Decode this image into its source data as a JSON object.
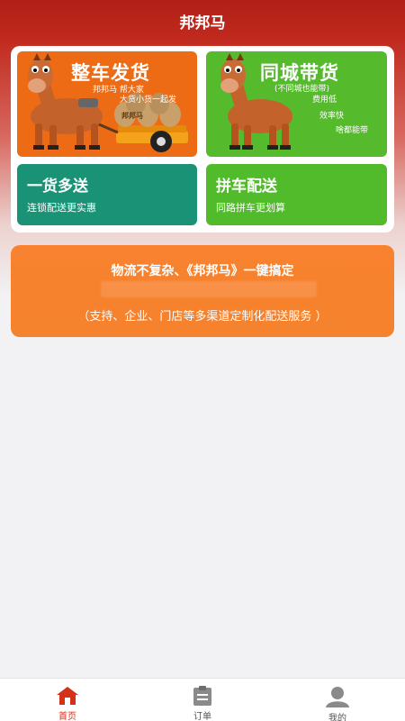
{
  "app": {
    "title": "邦邦马"
  },
  "tiles": {
    "whole_truck": {
      "title": "整车发货",
      "lines": [
        "邦邦马 帮大家",
        "大货小货一起发"
      ],
      "cart_label": "邦邦马"
    },
    "same_city": {
      "title": "同城带货",
      "subtitle": "(不同城也能带)",
      "features": [
        "费用低",
        "效率快",
        "啥都能带"
      ]
    },
    "multi_delivery": {
      "title": "一货多送",
      "subtitle": "连锁配送更实惠"
    },
    "shared_truck": {
      "title": "拼车配送",
      "subtitle": "同路拼车更划算"
    }
  },
  "promo": {
    "title": "物流不复杂、《邦邦马》一键搞定",
    "subtitle": "（支持、企业、门店等多渠道定制化配送服务 ）"
  },
  "tabbar": [
    {
      "label": "首页",
      "icon": "home-icon",
      "active": true
    },
    {
      "label": "订单",
      "icon": "order-clipboard-icon",
      "active": false
    },
    {
      "label": "我的",
      "icon": "profile-icon",
      "active": false
    }
  ],
  "colors": {
    "header": "#b01f16",
    "orange_tile": "#ee6b15",
    "green_tile": "#55ba2c",
    "teal_tile": "#1a9276",
    "lime_tile": "#52bb2b",
    "promo": "#f5822d",
    "tab_active": "#d4311b"
  }
}
